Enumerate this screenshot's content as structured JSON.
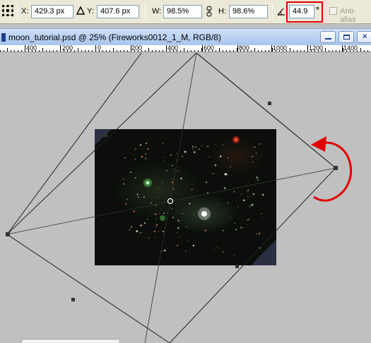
{
  "options_bar": {
    "x_label": "X:",
    "x_value": "429.3 px",
    "y_label": "Y:",
    "y_value": "407.6 px",
    "w_label": "W:",
    "w_value": "98.5%",
    "h_label": "H:",
    "h_value": "98.6%",
    "angle_value": "44.9",
    "degree_symbol": "°",
    "antialias_label": "Anti-alias",
    "antialias_checked": false,
    "highlight_color": "#e00000"
  },
  "document": {
    "title": "moon_tutorial.psd @ 25% (Fireworks0012_1_M, RGB/8)"
  },
  "ruler": {
    "labels": [
      "400",
      "200",
      "0",
      "200",
      "400",
      "600",
      "800",
      "1000",
      "1200",
      "1400"
    ]
  },
  "canvas": {
    "background_color": "#c0c0c0",
    "rotate_arrow_color": "#e00000"
  }
}
